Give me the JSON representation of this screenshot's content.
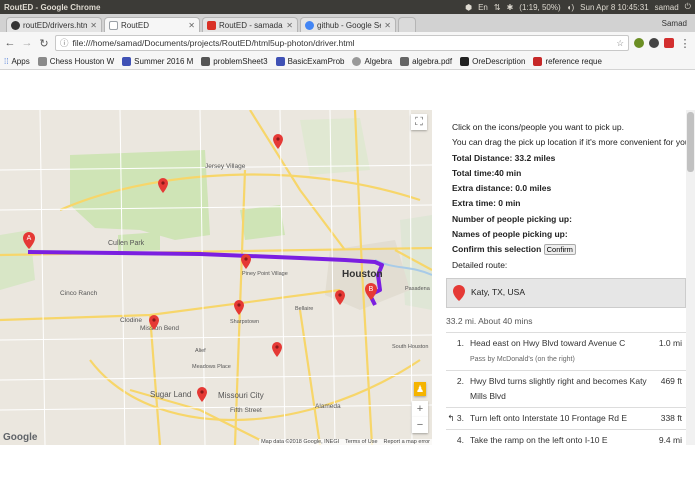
{
  "window": {
    "title": "RoutED - Google Chrome",
    "tray": {
      "battery": "(1:19, 50%)",
      "clock": "Sun Apr 8 10:45:31",
      "user": "samad"
    }
  },
  "tabs": [
    {
      "label": "routED/drivers.html",
      "favicon": "github-icon",
      "color": "#333333"
    },
    {
      "label": "RoutED",
      "favicon": "page-icon",
      "color": "#9aa0a6"
    },
    {
      "label": "RoutED - samadahm",
      "favicon": "gmail-icon",
      "color": "#d93025"
    },
    {
      "label": "github - Google Se",
      "favicon": "google-icon",
      "color": "#4285f4"
    }
  ],
  "profile_name": "Samad",
  "address": {
    "url": "file:///home/samad/Documents/projects/RoutED/html5up-photon/driver.html"
  },
  "bookmarks": [
    {
      "label": "Apps",
      "icon": "apps-grid-icon"
    },
    {
      "label": "Chess Houston W",
      "icon": "bookmark-favicon"
    },
    {
      "label": "Summer 2016 M",
      "icon": "bookmark-favicon"
    },
    {
      "label": "problemSheet3",
      "icon": "bookmark-favicon"
    },
    {
      "label": "BasicExamProb",
      "icon": "bookmark-favicon"
    },
    {
      "label": "Algebra",
      "icon": "bookmark-favicon"
    },
    {
      "label": "algebra.pdf",
      "icon": "pdf-icon"
    },
    {
      "label": "OreDescription",
      "icon": "bookmark-favicon"
    },
    {
      "label": "reference reque",
      "icon": "bookmark-favicon"
    }
  ],
  "map": {
    "route_color": "#7b1fe0",
    "labels": {
      "cullen_park": "Cullen Park",
      "houston": "Houston",
      "cinco_ranch": "Cinco Ranch",
      "mission_bend": "Mission Bend",
      "sugar_land": "Sugar Land",
      "missouri_city": "Missouri City",
      "piney_point": "Piney Point Village",
      "jersey_village": "Jersey Village",
      "clodine": "Clodine",
      "meadows_place": "Meadows Place",
      "sharpstown": "Sharpstown",
      "alief": "Alief",
      "fifth_street": "Fifth Street",
      "alameda": "Alameda",
      "south_houston": "South Houston",
      "bellaire": "Bellaire",
      "pasadena": "Pasadena"
    },
    "markers": {
      "a": "A",
      "b": "B"
    },
    "attribution": {
      "data": "Map data ©2018 Google, INEGI",
      "terms": "Terms of Use",
      "report": "Report a map error"
    },
    "logo": "Google"
  },
  "panel": {
    "intro1": "Click on the icons/people you want to pick up.",
    "intro2": "You can drag the pick up location if it's more convenient for you.",
    "total_distance": "Total Distance: 33.2 miles",
    "total_time": "Total time:40 min",
    "extra_distance": "Extra distance: 0.0 miles",
    "extra_time": "Extra time: 0 min",
    "num_people": "Number of people picking up:",
    "names_people": "Names of people picking up:",
    "confirm_label": "Confirm this selection",
    "confirm_button": "Confirm",
    "detailed_route": "Detailed route:",
    "destination": "Katy, TX, USA",
    "summary": "33.2 mi. About 40 mins",
    "steps": [
      {
        "num": "1.",
        "text": "Head east on Hwy Blvd toward Avenue C",
        "sub": "Pass by McDonald's (on the right)",
        "dist": "1.0 mi"
      },
      {
        "num": "2.",
        "text": "Hwy Blvd turns slightly right and becomes Katy Mills Blvd",
        "sub": "",
        "dist": "469 ft"
      },
      {
        "num": "3.",
        "text": "Turn left onto Interstate 10 Frontage Rd E",
        "sub": "",
        "dist": "338 ft"
      },
      {
        "num": "4.",
        "text": "Take the ramp on the left onto I-10 E",
        "sub": "",
        "dist": "9.4 mi"
      }
    ]
  }
}
